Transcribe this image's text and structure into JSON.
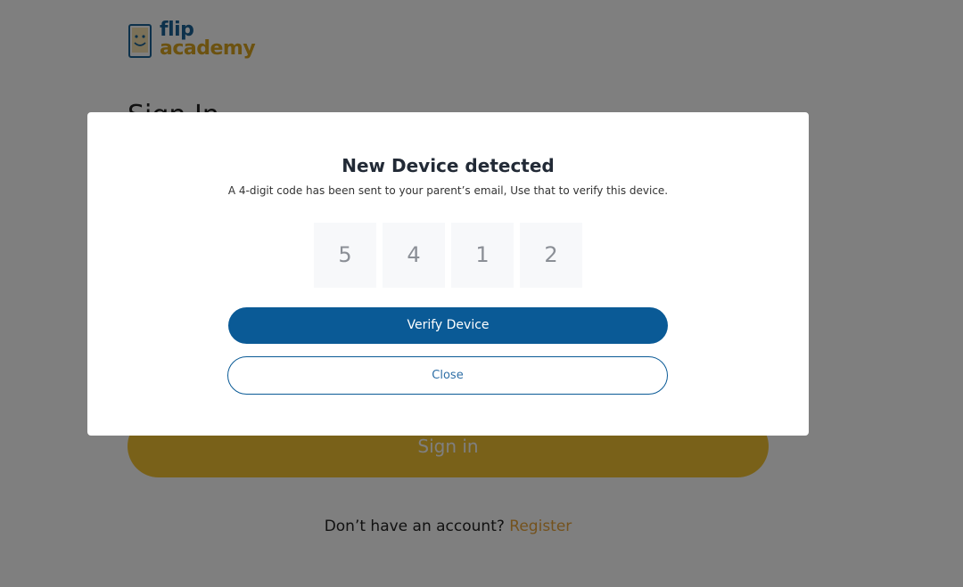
{
  "logo": {
    "line1": "flip",
    "line2": "academy"
  },
  "page": {
    "title": "Sign In",
    "signin_label": "Sign in",
    "register_prompt": "Don’t have an account?",
    "register_link": "Register"
  },
  "modal": {
    "title": "New Device detected",
    "subtitle": "A 4-digit code has been sent to your parent’s email, Use that to verify this device.",
    "code_digits": [
      "5",
      "4",
      "1",
      "2"
    ],
    "verify_label": "Verify Device",
    "close_label": "Close"
  },
  "colors": {
    "primary": "#0a5a96",
    "accent": "#f2c233",
    "link": "#e9a53a"
  }
}
